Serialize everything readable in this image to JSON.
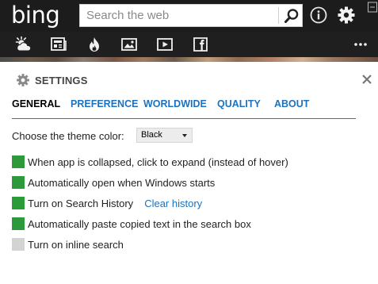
{
  "header": {
    "logo_text": "bing",
    "search_placeholder": "Search the web",
    "icons": [
      "search-icon",
      "info-icon",
      "gear-icon",
      "minimize-icon"
    ]
  },
  "categories": {
    "items": [
      {
        "name": "weather",
        "icon": "weather-icon"
      },
      {
        "name": "news",
        "icon": "news-icon"
      },
      {
        "name": "trending",
        "icon": "flame-icon"
      },
      {
        "name": "images",
        "icon": "image-icon"
      },
      {
        "name": "videos",
        "icon": "video-icon"
      },
      {
        "name": "facebook",
        "icon": "facebook-icon"
      }
    ],
    "more_icon": "more-icon"
  },
  "settings": {
    "title": "SETTINGS",
    "tabs": [
      {
        "label": "GENERAL",
        "active": true
      },
      {
        "label": "PREFERENCE",
        "active": false
      },
      {
        "label": "WORLDWIDE",
        "active": false
      },
      {
        "label": "QUALITY",
        "active": false
      },
      {
        "label": "ABOUT",
        "active": false
      }
    ],
    "theme": {
      "label": "Choose the theme color:",
      "value": "Black"
    },
    "options": [
      {
        "label": "When app is collapsed, click to expand (instead of hover)",
        "checked": true
      },
      {
        "label": "Automatically open when Windows starts",
        "checked": true
      },
      {
        "label": "Turn on Search History",
        "checked": true,
        "link": "Clear history"
      },
      {
        "label": "Automatically paste copied text in the search box",
        "checked": true
      },
      {
        "label": "Turn on inline search",
        "checked": false
      }
    ]
  },
  "colors": {
    "topbar": "#1c1c1c",
    "accent_link": "#1a73c2",
    "checkbox_on": "#2c9a3b",
    "checkbox_off": "#d3d3d3"
  }
}
